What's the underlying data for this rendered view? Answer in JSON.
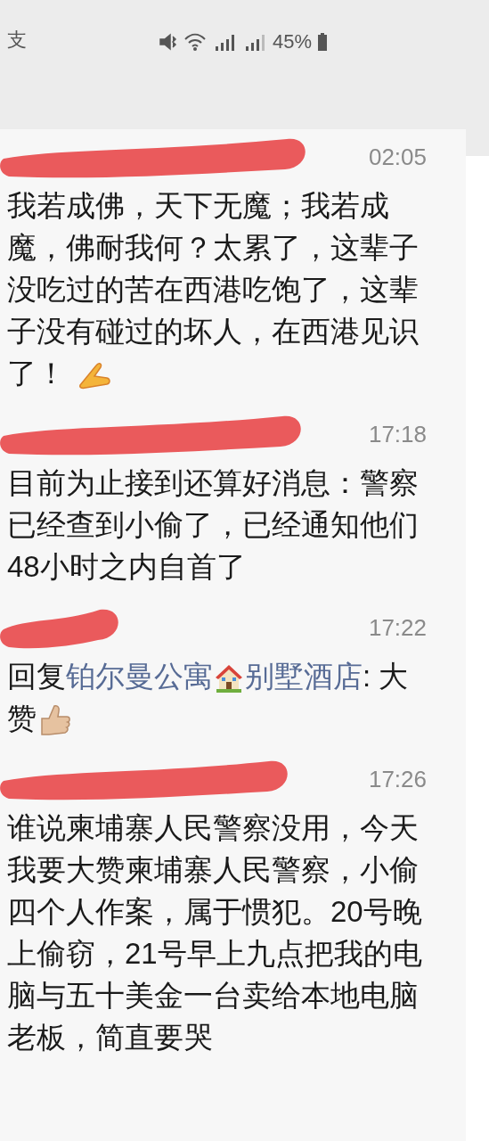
{
  "status_bar": {
    "notification": "支",
    "battery": "45%"
  },
  "comments": [
    {
      "time": "02:05",
      "parts": [
        {
          "kind": "text",
          "text": "我若成佛，天下无魔；我若成魔，佛耐我何？太累了，这辈子没吃过的苦在西港吃饱了，这辈子没有碰过的坏人，在西港见识了！"
        },
        {
          "kind": "hand"
        }
      ]
    },
    {
      "time": "17:18",
      "parts": [
        {
          "kind": "text",
          "text": "目前为止接到还算好消息：警察已经查到小偷了，已经通知他们48小时之内自首了"
        }
      ]
    },
    {
      "time": "17:22",
      "parts": [
        {
          "kind": "text",
          "text": "回复"
        },
        {
          "kind": "link",
          "text": "铂尔曼公寓"
        },
        {
          "kind": "house"
        },
        {
          "kind": "link",
          "text": "别墅酒店"
        },
        {
          "kind": "text",
          "text": ": 大赞"
        },
        {
          "kind": "thumb"
        }
      ]
    },
    {
      "time": "17:26",
      "parts": [
        {
          "kind": "text",
          "text": "谁说柬埔寨人民警察没用，今天我要大赞柬埔寨人民警察，小偷四个人作案，属于惯犯。20号晚上偷窃，21号早上九点把我的电脑与五十美金一台卖给本地电脑老板，简直要哭"
        }
      ]
    }
  ]
}
